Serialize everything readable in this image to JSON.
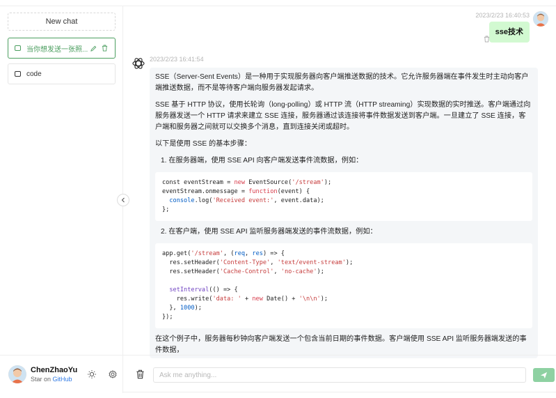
{
  "sidebar": {
    "new_chat_label": "New chat",
    "history": [
      {
        "label": "当你想发送一张照...",
        "active": true
      },
      {
        "label": "code",
        "active": false
      }
    ],
    "footer": {
      "user_name": "ChenZhaoYu",
      "star_prefix": "Star on",
      "star_link": "GitHub"
    }
  },
  "chat": {
    "user_message": {
      "time": "2023/2/23 16:40:53",
      "text": "sse技术"
    },
    "bot_message": {
      "time": "2023/2/23 16:41:54",
      "p1": "SSE（Server-Sent Events）是一种用于实现服务器向客户端推送数据的技术。它允许服务器端在事件发生时主动向客户端推送数据，而不是等待客户端向服务器发起请求。",
      "p2": "SSE 基于 HTTP 协议，使用长轮询（long-polling）或 HTTP 流（HTTP streaming）实现数据的实时推送。客户端通过向服务器发送一个 HTTP 请求来建立 SSE 连接，服务器通过该连接将事件数据发送到客户端。一旦建立了 SSE 连接，客户端和服务器之间就可以交换多个消息，直到连接关闭或超时。",
      "p3": "以下是使用 SSE 的基本步骤：",
      "step1": "1. 在服务器端，使用 SSE API 向客户端发送事件流数据，例如：",
      "step2": "2. 在客户端，使用 SSE API 监听服务器端发送的事件流数据，例如：",
      "p4": "在这个例子中，服务器每秒钟向客户端发送一个包含当前日期的事件数据。客户端使用 SSE API 监听服务器端发送的事件数据，"
    }
  },
  "input": {
    "placeholder": "Ask me anything..."
  },
  "colors": {
    "accent": "#4b9e5f",
    "user_bubble": "#d2f9d1",
    "bot_bubble": "#f4f6f8",
    "send_button": "#8ed1a2"
  }
}
